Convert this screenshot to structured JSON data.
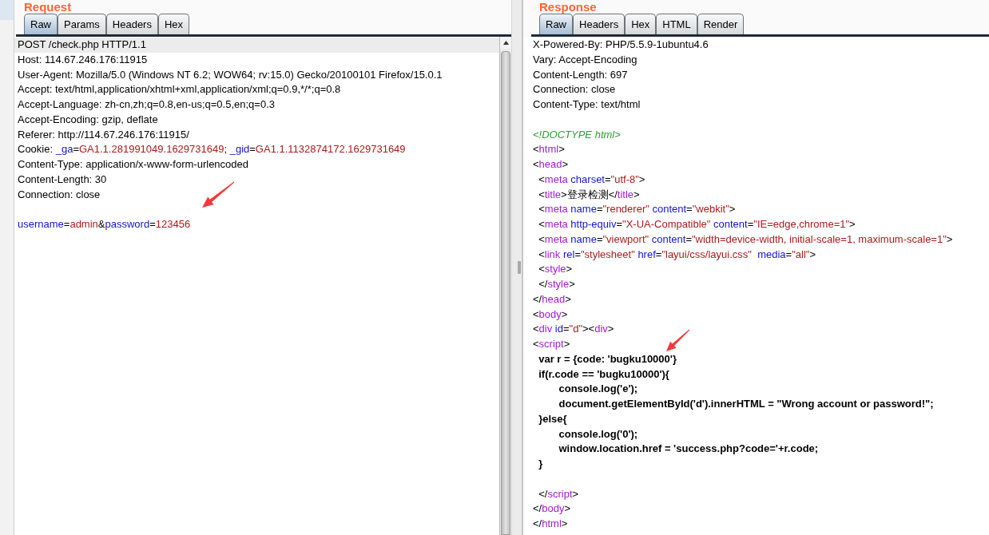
{
  "request": {
    "title": "Request",
    "tabs": [
      {
        "label": "Raw",
        "selected": true
      },
      {
        "label": "Params",
        "selected": false
      },
      {
        "label": "Headers",
        "selected": false
      },
      {
        "label": "Hex",
        "selected": false
      }
    ],
    "lines": [
      {
        "kind": "code",
        "highlighted": true,
        "segments": [
          {
            "kind": "text",
            "text": "POST /check.php HTTP/1.1"
          }
        ]
      },
      {
        "kind": "code",
        "highlighted": false,
        "segments": [
          {
            "kind": "text",
            "text": "Host: 114.67.246.176:11915"
          }
        ]
      },
      {
        "kind": "code",
        "highlighted": false,
        "segments": [
          {
            "kind": "text",
            "text": "User-Agent: Mozilla/5.0 (Windows NT 6.2; WOW64; rv:15.0) Gecko/20100101 Firefox/15.0.1"
          }
        ]
      },
      {
        "kind": "code",
        "highlighted": false,
        "segments": [
          {
            "kind": "text",
            "text": "Accept: text/html,application/xhtml+xml,application/xml;q=0.9,*/*;q=0.8"
          }
        ]
      },
      {
        "kind": "code",
        "highlighted": false,
        "segments": [
          {
            "kind": "text",
            "text": "Accept-Language: zh-cn,zh;q=0.8,en-us;q=0.5,en;q=0.3"
          }
        ]
      },
      {
        "kind": "code",
        "highlighted": false,
        "segments": [
          {
            "kind": "text",
            "text": "Accept-Encoding: gzip, deflate"
          }
        ]
      },
      {
        "kind": "code",
        "highlighted": false,
        "segments": [
          {
            "kind": "text",
            "text": "Referer: http://114.67.246.176:11915/"
          }
        ]
      },
      {
        "kind": "code",
        "highlighted": false,
        "segments": [
          {
            "kind": "text",
            "text": "Cookie: "
          },
          {
            "kind": "attr",
            "text": "_ga"
          },
          {
            "kind": "text",
            "text": "="
          },
          {
            "kind": "value",
            "text": "GA1.1.281991049.1629731649"
          },
          {
            "kind": "text",
            "text": "; "
          },
          {
            "kind": "attr",
            "text": "_gid"
          },
          {
            "kind": "text",
            "text": "="
          },
          {
            "kind": "value",
            "text": "GA1.1.1132874172.1629731649"
          }
        ]
      },
      {
        "kind": "code",
        "highlighted": false,
        "segments": [
          {
            "kind": "text",
            "text": "Content-Type: application/x-www-form-urlencoded"
          }
        ]
      },
      {
        "kind": "code",
        "highlighted": false,
        "segments": [
          {
            "kind": "text",
            "text": "Content-Length: 30"
          }
        ]
      },
      {
        "kind": "code",
        "highlighted": false,
        "segments": [
          {
            "kind": "text",
            "text": "Connection: close"
          }
        ]
      },
      {
        "kind": "blank",
        "highlighted": false
      },
      {
        "kind": "code",
        "highlighted": false,
        "segments": [
          {
            "kind": "attr",
            "text": "username"
          },
          {
            "kind": "text",
            "text": "="
          },
          {
            "kind": "value",
            "text": "admin"
          },
          {
            "kind": "text",
            "text": "&"
          },
          {
            "kind": "attr",
            "text": "password"
          },
          {
            "kind": "text",
            "text": "="
          },
          {
            "kind": "value",
            "text": "123456"
          }
        ]
      }
    ]
  },
  "response": {
    "title": "Response",
    "tabs": [
      {
        "label": "Raw",
        "selected": true
      },
      {
        "label": "Headers",
        "selected": false
      },
      {
        "label": "Hex",
        "selected": false
      },
      {
        "label": "HTML",
        "selected": false
      },
      {
        "label": "Render",
        "selected": false
      }
    ],
    "lines": [
      {
        "kind": "code",
        "segments": [
          {
            "kind": "text",
            "text": "X-Powered-By: PHP/5.5.9-1ubuntu4.6"
          }
        ]
      },
      {
        "kind": "code",
        "segments": [
          {
            "kind": "text",
            "text": "Vary: Accept-Encoding"
          }
        ]
      },
      {
        "kind": "code",
        "segments": [
          {
            "kind": "text",
            "text": "Content-Length: 697"
          }
        ]
      },
      {
        "kind": "code",
        "segments": [
          {
            "kind": "text",
            "text": "Connection: close"
          }
        ]
      },
      {
        "kind": "code",
        "segments": [
          {
            "kind": "text",
            "text": "Content-Type: text/html"
          }
        ]
      },
      {
        "kind": "blank"
      },
      {
        "kind": "code",
        "segments": [
          {
            "kind": "doctype",
            "text": "<!DOCTYPE html>"
          }
        ]
      },
      {
        "kind": "code",
        "segments": [
          {
            "kind": "text",
            "text": "<"
          },
          {
            "kind": "tag",
            "text": "html"
          },
          {
            "kind": "text",
            "text": ">"
          }
        ]
      },
      {
        "kind": "code",
        "segments": [
          {
            "kind": "text",
            "text": "<"
          },
          {
            "kind": "tag",
            "text": "head"
          },
          {
            "kind": "text",
            "text": ">"
          }
        ]
      },
      {
        "kind": "code",
        "segments": [
          {
            "kind": "text",
            "text": "  <"
          },
          {
            "kind": "tag",
            "text": "meta"
          },
          {
            "kind": "attr",
            "text": " charset"
          },
          {
            "kind": "text",
            "text": "="
          },
          {
            "kind": "value",
            "text": "\"utf-8\""
          },
          {
            "kind": "text",
            "text": ">"
          }
        ]
      },
      {
        "kind": "code",
        "segments": [
          {
            "kind": "text",
            "text": "  <"
          },
          {
            "kind": "tag",
            "text": "title"
          },
          {
            "kind": "text",
            "text": ">登录检测</"
          },
          {
            "kind": "tag",
            "text": "title"
          },
          {
            "kind": "text",
            "text": ">"
          }
        ]
      },
      {
        "kind": "code",
        "segments": [
          {
            "kind": "text",
            "text": "  <"
          },
          {
            "kind": "tag",
            "text": "meta"
          },
          {
            "kind": "attr",
            "text": " name"
          },
          {
            "kind": "text",
            "text": "="
          },
          {
            "kind": "value",
            "text": "\"renderer\""
          },
          {
            "kind": "attr",
            "text": " content"
          },
          {
            "kind": "text",
            "text": "="
          },
          {
            "kind": "value",
            "text": "\"webkit\""
          },
          {
            "kind": "text",
            "text": ">"
          }
        ]
      },
      {
        "kind": "code",
        "segments": [
          {
            "kind": "text",
            "text": "  <"
          },
          {
            "kind": "tag",
            "text": "meta"
          },
          {
            "kind": "attr",
            "text": " http-equiv"
          },
          {
            "kind": "text",
            "text": "="
          },
          {
            "kind": "value",
            "text": "\"X-UA-Compatible\""
          },
          {
            "kind": "attr",
            "text": " content"
          },
          {
            "kind": "text",
            "text": "="
          },
          {
            "kind": "value",
            "text": "\"IE=edge,chrome=1\""
          },
          {
            "kind": "text",
            "text": ">"
          }
        ]
      },
      {
        "kind": "code",
        "segments": [
          {
            "kind": "text",
            "text": "  <"
          },
          {
            "kind": "tag",
            "text": "meta"
          },
          {
            "kind": "attr",
            "text": " name"
          },
          {
            "kind": "text",
            "text": "="
          },
          {
            "kind": "value",
            "text": "\"viewport\""
          },
          {
            "kind": "attr",
            "text": " content"
          },
          {
            "kind": "text",
            "text": "="
          },
          {
            "kind": "value",
            "text": "\"width=device-width, initial-scale=1, maximum-scale=1\""
          },
          {
            "kind": "text",
            "text": ">"
          }
        ]
      },
      {
        "kind": "code",
        "segments": [
          {
            "kind": "text",
            "text": "  <"
          },
          {
            "kind": "tag",
            "text": "link"
          },
          {
            "kind": "attr",
            "text": " rel"
          },
          {
            "kind": "text",
            "text": "="
          },
          {
            "kind": "value",
            "text": "\"stylesheet\""
          },
          {
            "kind": "attr",
            "text": " href"
          },
          {
            "kind": "text",
            "text": "="
          },
          {
            "kind": "value",
            "text": "\"layui/css/layui.css\""
          },
          {
            "kind": "attr",
            "text": "  media"
          },
          {
            "kind": "text",
            "text": "="
          },
          {
            "kind": "value",
            "text": "\"all\""
          },
          {
            "kind": "text",
            "text": ">"
          }
        ]
      },
      {
        "kind": "code",
        "segments": [
          {
            "kind": "text",
            "text": "  <"
          },
          {
            "kind": "tag",
            "text": "style"
          },
          {
            "kind": "text",
            "text": ">"
          }
        ]
      },
      {
        "kind": "code",
        "segments": [
          {
            "kind": "text",
            "text": "  </"
          },
          {
            "kind": "tag",
            "text": "style"
          },
          {
            "kind": "text",
            "text": ">"
          }
        ]
      },
      {
        "kind": "code",
        "segments": [
          {
            "kind": "text",
            "text": "</"
          },
          {
            "kind": "tag",
            "text": "head"
          },
          {
            "kind": "text",
            "text": ">"
          }
        ]
      },
      {
        "kind": "code",
        "segments": [
          {
            "kind": "text",
            "text": "<"
          },
          {
            "kind": "tag",
            "text": "body"
          },
          {
            "kind": "text",
            "text": ">"
          }
        ]
      },
      {
        "kind": "code",
        "segments": [
          {
            "kind": "text",
            "text": "<"
          },
          {
            "kind": "tag",
            "text": "div"
          },
          {
            "kind": "attr",
            "text": " id"
          },
          {
            "kind": "text",
            "text": "="
          },
          {
            "kind": "value",
            "text": "\"d\""
          },
          {
            "kind": "text",
            "text": "><"
          },
          {
            "kind": "tag",
            "text": "div"
          },
          {
            "kind": "text",
            "text": ">"
          }
        ]
      },
      {
        "kind": "code",
        "segments": [
          {
            "kind": "text",
            "text": "<"
          },
          {
            "kind": "tag",
            "text": "script"
          },
          {
            "kind": "text",
            "text": ">"
          }
        ]
      },
      {
        "kind": "code",
        "segments": [
          {
            "kind": "script",
            "text": "  var r = {code: 'bugku10000'}"
          }
        ]
      },
      {
        "kind": "code",
        "segments": [
          {
            "kind": "script",
            "text": "  if(r.code == 'bugku10000'){"
          }
        ]
      },
      {
        "kind": "code",
        "segments": [
          {
            "kind": "script",
            "text": "         console.log('e');"
          }
        ]
      },
      {
        "kind": "code",
        "segments": [
          {
            "kind": "script",
            "text": "         document.getElementById('d').innerHTML = \"Wrong account or password!\";"
          }
        ]
      },
      {
        "kind": "code",
        "segments": [
          {
            "kind": "script",
            "text": "  }else{"
          }
        ]
      },
      {
        "kind": "code",
        "segments": [
          {
            "kind": "script",
            "text": "         console.log('0');"
          }
        ]
      },
      {
        "kind": "code",
        "segments": [
          {
            "kind": "script",
            "text": "         window.location.href = 'success.php?code='+r.code;"
          }
        ]
      },
      {
        "kind": "code",
        "segments": [
          {
            "kind": "script",
            "text": "  }"
          }
        ]
      },
      {
        "kind": "blank"
      },
      {
        "kind": "code",
        "segments": [
          {
            "kind": "text",
            "text": "  </"
          },
          {
            "kind": "tag",
            "text": "script"
          },
          {
            "kind": "text",
            "text": ">"
          }
        ]
      },
      {
        "kind": "code",
        "segments": [
          {
            "kind": "text",
            "text": "</"
          },
          {
            "kind": "tag",
            "text": "body"
          },
          {
            "kind": "text",
            "text": ">"
          }
        ]
      },
      {
        "kind": "code",
        "segments": [
          {
            "kind": "text",
            "text": "</"
          },
          {
            "kind": "tag",
            "text": "html"
          },
          {
            "kind": "text",
            "text": ">"
          }
        ]
      }
    ]
  }
}
